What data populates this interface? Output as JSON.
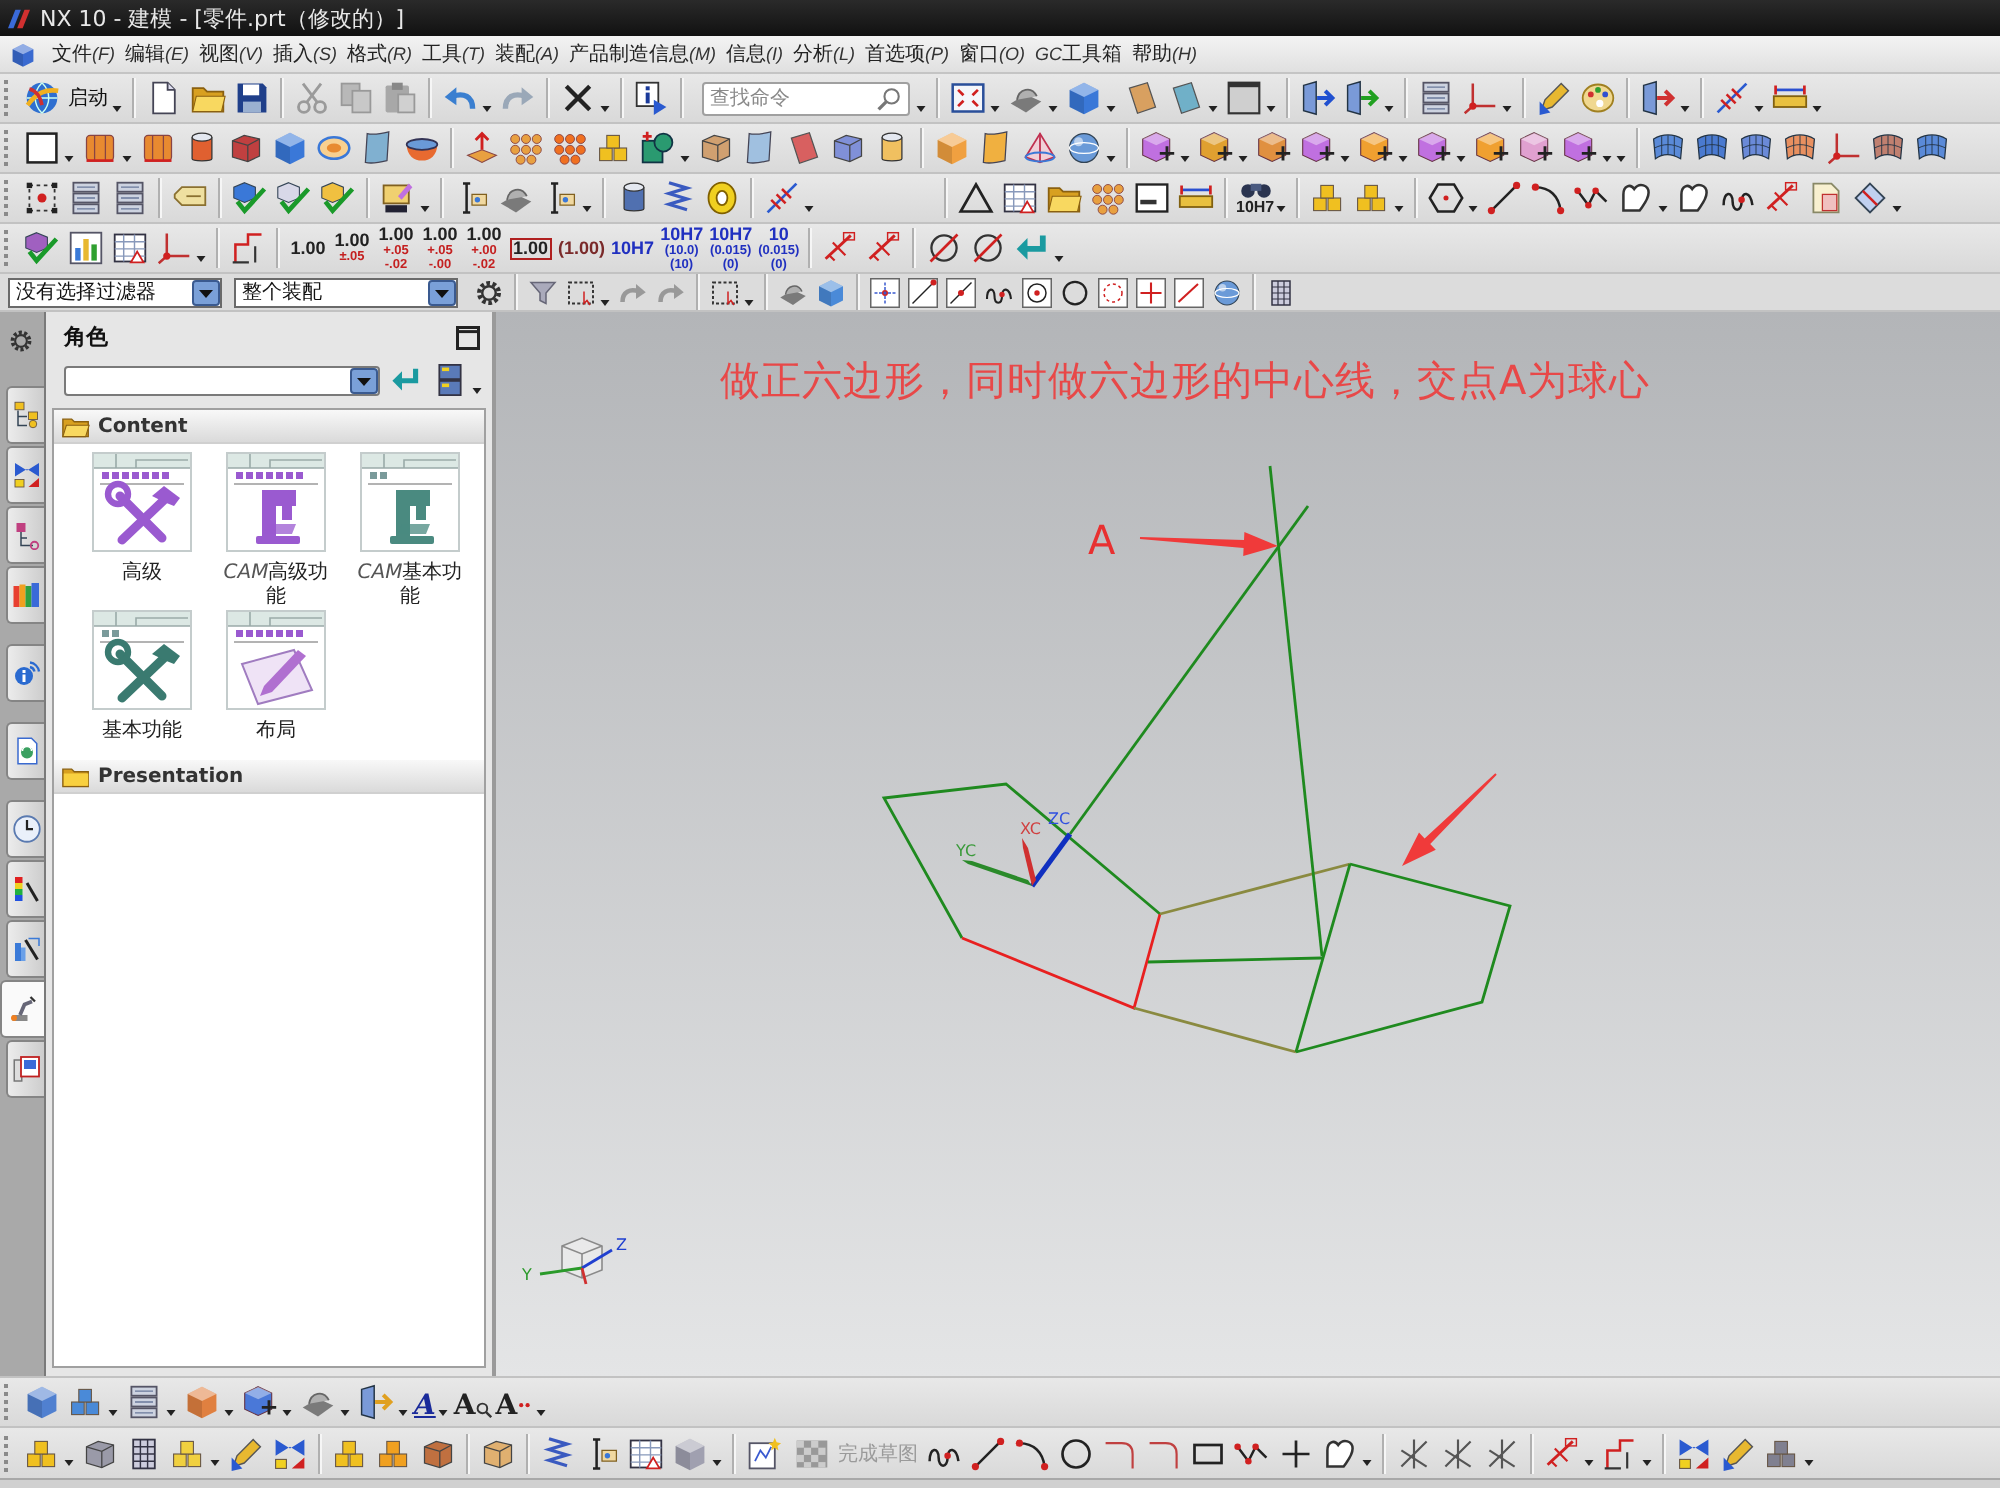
{
  "window": {
    "title": "NX 10 - 建模 - [零件.prt（修改的）]"
  },
  "menu_bar": [
    {
      "label": "文件",
      "key": "(F)"
    },
    {
      "label": "编辑",
      "key": "(E)"
    },
    {
      "label": "视图",
      "key": "(V)"
    },
    {
      "label": "插入",
      "key": "(S)"
    },
    {
      "label": "格式",
      "key": "(R)"
    },
    {
      "label": "工具",
      "key": "(T)"
    },
    {
      "label": "装配",
      "key": "(A)"
    },
    {
      "label": "产品制造信息",
      "key": "(M)"
    },
    {
      "label": "信息",
      "key": "(I)"
    },
    {
      "label": "分析",
      "key": "(L)"
    },
    {
      "label": "首选项",
      "key": "(P)"
    },
    {
      "label": "窗口",
      "key": "(O)"
    },
    {
      "prefix": "GC",
      "label": "工具箱"
    },
    {
      "label": "帮助",
      "key": "(H)"
    }
  ],
  "toolbar": {
    "start": "启动",
    "search": {
      "placeholder": "查找命令"
    },
    "tolerance_fit": "10H7",
    "dimension_styles": [
      {
        "kind": "plain",
        "value": "1.00"
      },
      {
        "kind": "tolerance",
        "value": "1.00",
        "limits": [
          "±.05"
        ]
      },
      {
        "kind": "tolerance",
        "value": "1.00",
        "limits": [
          "+.05",
          "-.02"
        ]
      },
      {
        "kind": "tolerance",
        "value": "1.00",
        "limits": [
          "+.05",
          "-.00"
        ]
      },
      {
        "kind": "tolerance",
        "value": "1.00",
        "limits": [
          "+.00",
          "-.02"
        ]
      },
      {
        "kind": "basic",
        "value": "1.00"
      },
      {
        "kind": "reference",
        "value": "(1.00)"
      },
      {
        "kind": "fit",
        "value": "10H7"
      },
      {
        "kind": "fit",
        "value": "10H7",
        "limits": [
          "(10.0)",
          "(10)"
        ]
      },
      {
        "kind": "fit",
        "value": "10H7",
        "limits": [
          "(0.015)",
          "(0)"
        ]
      },
      {
        "kind": "fit",
        "value": "10",
        "limits": [
          "(0.015)",
          "(0)"
        ]
      }
    ]
  },
  "selection_bar": {
    "type_filter": "没有选择过滤器",
    "scope": "整个装配"
  },
  "resource_bar": {
    "tabs": [
      {
        "selected": false
      },
      {
        "selected": false
      },
      {
        "selected": false
      },
      {
        "selected": false
      },
      {
        "selected": false
      },
      {
        "selected": false
      },
      {
        "selected": false
      },
      {
        "selected": false
      },
      {
        "selected": false
      },
      {
        "selected": true
      },
      {
        "selected": false
      }
    ]
  },
  "role_panel": {
    "title": "角色",
    "sections": [
      {
        "title": "Content",
        "items": [
          {
            "label": "高级"
          },
          {
            "prefix": "CAM",
            "label": "高级功能"
          },
          {
            "prefix": "CAM",
            "label": "基本功能"
          },
          {
            "label": "基本功能"
          },
          {
            "label": "布局"
          }
        ]
      },
      {
        "title": "Presentation"
      }
    ]
  },
  "canvas": {
    "note": "做正六边形，同时做六边形的中心线，交点A为球心",
    "point_label": "A",
    "wcs_labels": [
      "XC",
      "YC",
      "ZC"
    ],
    "view_triad_labels": [
      "Y",
      "Z"
    ]
  },
  "bottom_toolbar": {
    "text_tools": [
      "A",
      "A",
      "A"
    ],
    "finish_sketch": {
      "label": "完成草图",
      "disabled": true
    }
  }
}
